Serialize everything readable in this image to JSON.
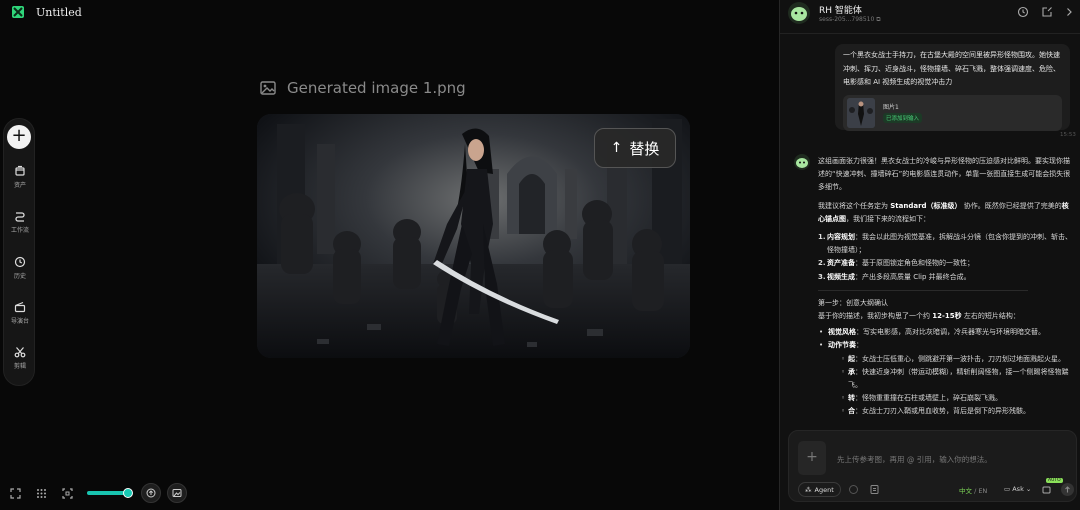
{
  "app": {
    "title": "Untitled",
    "logo_icon": "app-logo-icon"
  },
  "sidebar": {
    "add_icon": "plus-icon",
    "items": [
      {
        "label": "资产",
        "icon": "asset-icon"
      },
      {
        "label": "工作流",
        "icon": "workflow-icon"
      },
      {
        "label": "历史",
        "icon": "history-icon"
      },
      {
        "label": "导演台",
        "icon": "director-icon"
      },
      {
        "label": "剪辑",
        "icon": "scissors-icon"
      }
    ]
  },
  "canvas": {
    "file_name": "Generated image 1.png",
    "replace_label": "替换",
    "replace_icon": "arrow-up-icon"
  },
  "bottom_bar": {
    "zoom_fraction": 0.92,
    "accent": "#19c4b0"
  },
  "panel": {
    "agent_name": "RH 智能体",
    "session": "sess-205...798510",
    "user_message": {
      "text": "一个黑衣女战士手持刀，在古堡大殿的空间里被异形怪物围攻。她快速冲刺、挥刀、近身战斗，怪物撞墙、碎石飞溅，整体强调速度、危险、电影感和 AI 视频生成的视觉冲击力",
      "attachment_name": "图片1",
      "attachment_tag": "已添加到输入",
      "time": "15:53"
    },
    "bot_message": {
      "p1": "这组画面张力很强！黑衣女战士的冷峻与异形怪物的压迫感对比鲜明。要实现你描述的“快速冲刺、撞墙碎石”的电影感连贯动作，单靠一张图直接生成可能会损失很多细节。",
      "p2_pre": "我建议将这个任务定为 ",
      "p2_bold": "Standard（标准级）",
      "p2_mid": " 协作。既然你已经提供了完美的",
      "p2_bold2": "核心锚点图",
      "p2_post": "，我们接下来的流程如下：",
      "steps": [
        {
          "num": "1.",
          "title": "内容规划",
          "text": "：我会以此图为视觉基准，拆解战斗分镜（包含你提到的冲刺、斩击、怪物撞墙）；"
        },
        {
          "num": "2.",
          "title": "资产准备",
          "text": "：基于原图锁定角色和怪物的一致性；"
        },
        {
          "num": "3.",
          "title": "视频生成",
          "text": "：产出多段高质量 Clip 并最终合成。"
        }
      ],
      "step_heading": "第一步：创意大纲确认",
      "outline_pre": "基于你的描述，我初步构思了一个约 ",
      "outline_bold": "12-15秒",
      "outline_post": " 左右的短片结构：",
      "bullets": [
        {
          "title": "视觉风格",
          "text": "：写实电影感，高对比灰暗调，冷兵器寒光与环境明暗交替。"
        },
        {
          "title": "动作节奏",
          "text": "："
        }
      ],
      "sub_bullets": [
        {
          "title": "起",
          "text": "：女战士压低重心，侧跳避开第一波扑击，刀刃划过地面溅起火星。"
        },
        {
          "title": "承",
          "text": "：快速近身冲刺（带运动模糊），精斩削阔怪物，接一个侧踢将怪物踹飞。"
        },
        {
          "title": "转",
          "text": "：怪物重重撞在石柱或墙壁上，碎石崩裂飞溅。"
        },
        {
          "title": "合",
          "text": "：女战士刀刃入鞘或甩血收势，背后是倒下的异形残骸。"
        }
      ]
    },
    "input": {
      "placeholder": "先上传参考图，再用 @ 引用，输入你的想法。",
      "agent_label": "Agent",
      "lang_on": "中文",
      "lang_sep": " / ",
      "lang_off": "EN",
      "ask_label": "Ask",
      "auto_tag": "AUTO"
    }
  }
}
